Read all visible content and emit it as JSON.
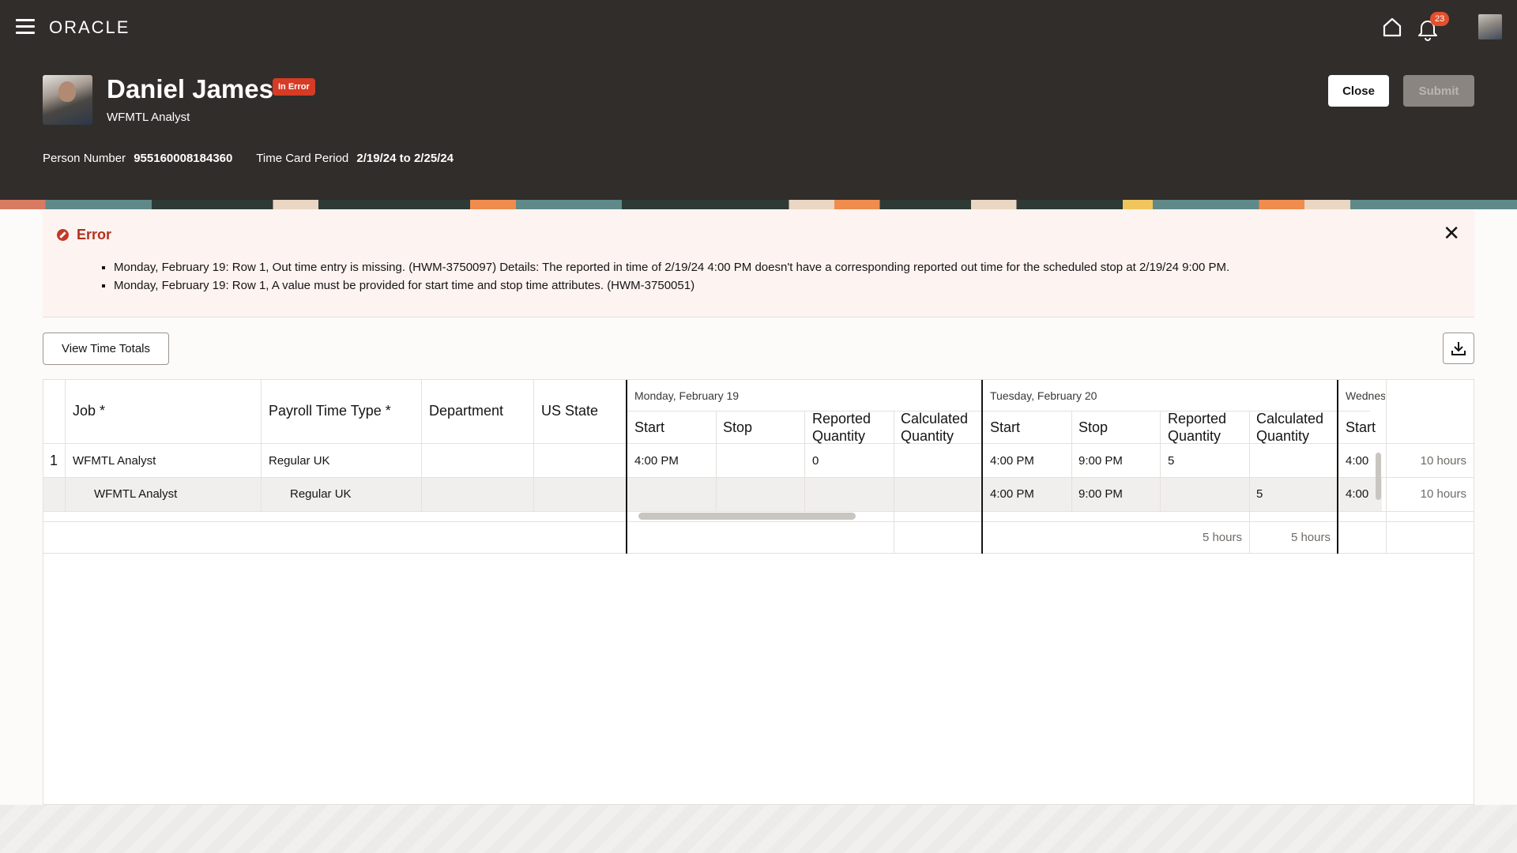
{
  "header": {
    "logo": "ORACLE",
    "notification_count": "23",
    "person_name": "Daniel James",
    "status": "In Error",
    "job_title": "WFMTL Analyst",
    "close_label": "Close",
    "submit_label": "Submit",
    "person_number_label": "Person Number",
    "person_number": "955160008184360",
    "period_label": "Time Card Period",
    "period": "2/19/24 to 2/25/24"
  },
  "error": {
    "title": "Error",
    "messages": [
      "Monday, February 19: Row 1, Out time entry is missing. (HWM-3750097) Details: The reported in time of 2/19/24 4:00 PM doesn't have a corresponding reported out time for the scheduled stop at 2/19/24 9:00 PM.",
      "Monday, February 19: Row 1, A value must be provided for start time and stop time attributes. (HWM-3750051)"
    ]
  },
  "toolbar": {
    "view_totals_label": "View Time Totals"
  },
  "table": {
    "columns": {
      "job": "Job *",
      "payroll": "Payroll Time Type *",
      "department": "Department",
      "state": "US State"
    },
    "days": [
      {
        "label": "Monday, February 19",
        "start": "Start",
        "stop": "Stop",
        "reported": "Reported Quantity",
        "calculated": "Calculated Quantity"
      },
      {
        "label": "Tuesday, February 20",
        "start": "Start",
        "stop": "Stop",
        "reported": "Reported Quantity",
        "calculated": "Calculated Quantity"
      },
      {
        "label": "Wednes",
        "start": "Start"
      }
    ],
    "rows": [
      {
        "num": "1",
        "job": "WFMTL Analyst",
        "payroll": "Regular UK",
        "mon": {
          "start": "4:00 PM",
          "stop": "",
          "reported": "0",
          "calculated": ""
        },
        "tue": {
          "start": "4:00 PM",
          "stop": "9:00 PM",
          "reported": "5",
          "calculated": ""
        },
        "wed_start": "4:00",
        "total": "10 hours"
      },
      {
        "num": "",
        "job": "WFMTL Analyst",
        "payroll": "Regular UK",
        "mon": {
          "start": "",
          "stop": "",
          "reported": "",
          "calculated": ""
        },
        "tue": {
          "start": "4:00 PM",
          "stop": "9:00 PM",
          "reported": "",
          "calculated": "5"
        },
        "wed_start": "4:00",
        "total": "10 hours"
      }
    ],
    "totals": {
      "tue_reported": "5 hours",
      "tue_calculated": "5 hours"
    }
  }
}
